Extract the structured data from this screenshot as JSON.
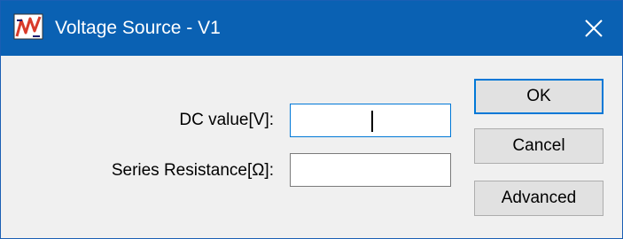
{
  "window": {
    "title": "Voltage Source - V1",
    "app_icon": "voltage-source-icon",
    "close_icon": "close-icon",
    "accent_color": "#0a61b3"
  },
  "form": {
    "dc_value": {
      "label": "DC value[V]:",
      "value": ""
    },
    "series_resistance": {
      "label": "Series Resistance[Ω]:",
      "value": ""
    }
  },
  "buttons": {
    "ok_label": "OK",
    "cancel_label": "Cancel",
    "advanced_label": "Advanced"
  }
}
